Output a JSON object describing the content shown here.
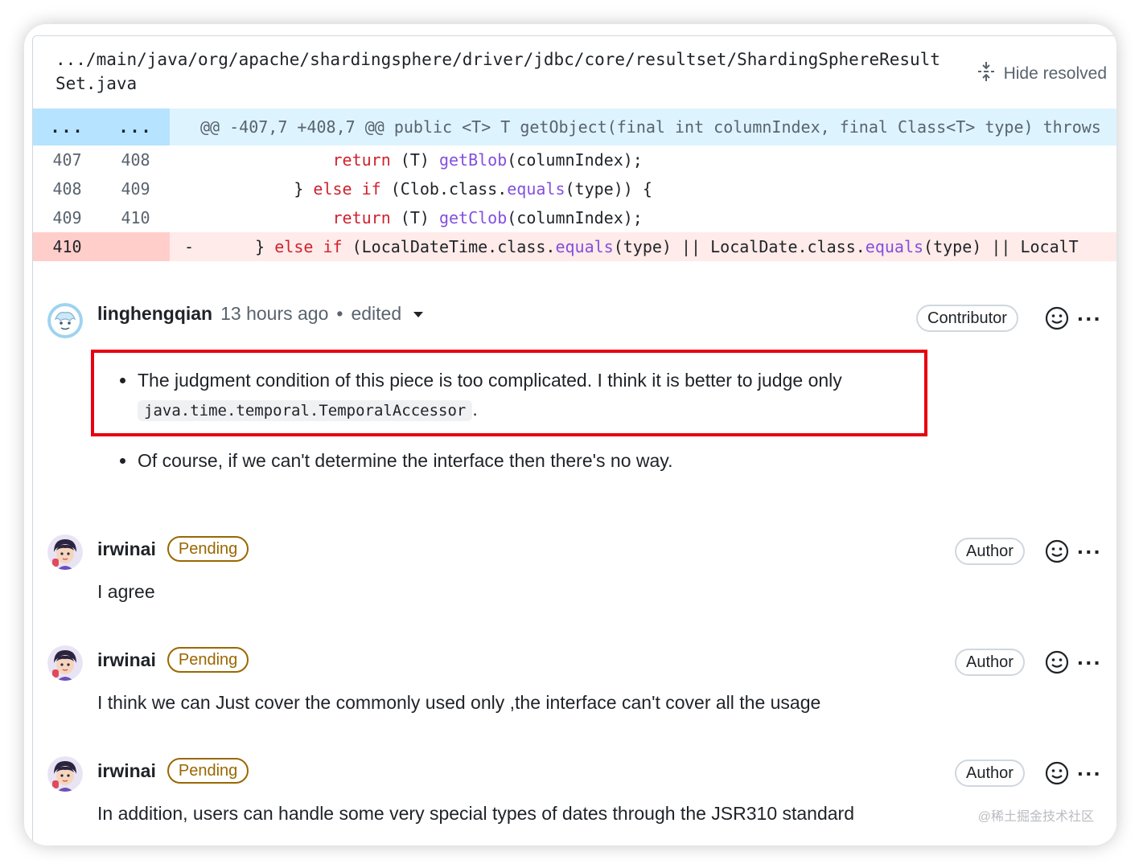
{
  "file": {
    "path": ".../main/java/org/apache/shardingsphere/driver/jdbc/core/resultset/ShardingSphereResultSet.java",
    "hide_resolved_label": "Hide resolved"
  },
  "diff": {
    "hunk": {
      "left": "...",
      "right": "...",
      "header": "@@ -407,7 +408,7 @@ public <T> T getObject(final int columnIndex, final Class<T> type) throws"
    },
    "lines": [
      {
        "old": "407",
        "new": "408",
        "type": "context",
        "tokens": [
          {
            "t": "            ",
            "c": ""
          },
          {
            "t": "return",
            "c": "kw"
          },
          {
            "t": " (T) ",
            "c": ""
          },
          {
            "t": "getBlob",
            "c": "fn"
          },
          {
            "t": "(columnIndex);",
            "c": ""
          }
        ]
      },
      {
        "old": "408",
        "new": "409",
        "type": "context",
        "tokens": [
          {
            "t": "        } ",
            "c": ""
          },
          {
            "t": "else if",
            "c": "kw"
          },
          {
            "t": " (Clob.class.",
            "c": ""
          },
          {
            "t": "equals",
            "c": "fn"
          },
          {
            "t": "(type)) {",
            "c": ""
          }
        ]
      },
      {
        "old": "409",
        "new": "410",
        "type": "context",
        "tokens": [
          {
            "t": "            ",
            "c": ""
          },
          {
            "t": "return",
            "c": "kw"
          },
          {
            "t": " (T) ",
            "c": ""
          },
          {
            "t": "getClob",
            "c": "fn"
          },
          {
            "t": "(columnIndex);",
            "c": ""
          }
        ]
      },
      {
        "old": "410",
        "new": "",
        "type": "deletion",
        "sign": "-",
        "tokens": [
          {
            "t": "    } ",
            "c": ""
          },
          {
            "t": "else if",
            "c": "kw"
          },
          {
            "t": " (LocalDateTime.class.",
            "c": ""
          },
          {
            "t": "equals",
            "c": "fn"
          },
          {
            "t": "(type) || LocalDate.class.",
            "c": ""
          },
          {
            "t": "equals",
            "c": "fn"
          },
          {
            "t": "(type) || LocalT",
            "c": ""
          }
        ]
      }
    ]
  },
  "comments": [
    {
      "author": "linghengqian",
      "time": "13 hours ago",
      "edited": "edited",
      "role": "Contributor",
      "bullet1_text": "The judgment condition of this piece is too complicated. I think it is better to judge only",
      "bullet1_code": "java.time.temporal.TemporalAccessor",
      "bullet1_end": ".",
      "bullet2_text": "Of course, if we can't determine the interface then there's no way."
    },
    {
      "author": "irwinai",
      "badge": "Pending",
      "role": "Author",
      "body": "I agree"
    },
    {
      "author": "irwinai",
      "badge": "Pending",
      "role": "Author",
      "body": "I think we can Just cover the commonly used only ,the interface can't cover all the usage"
    },
    {
      "author": "irwinai",
      "badge": "Pending",
      "role": "Author",
      "body": "In addition, users can handle some very special types of dates through the JSR310 standard"
    }
  ],
  "watermark": "@稀土掘金技术社区",
  "colors": {
    "highlight": "#e60012",
    "pending": "#9a6700",
    "hunk_bg": "#ddf4ff",
    "deletion_bg": "#ffebe9"
  }
}
